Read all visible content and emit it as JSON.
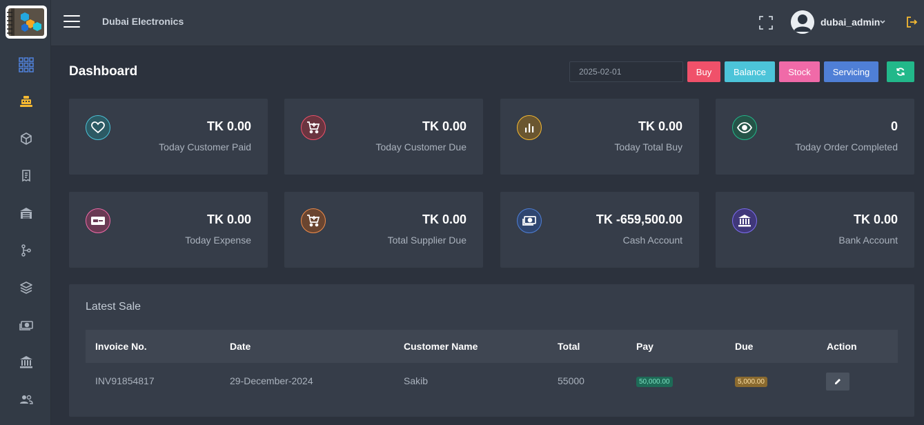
{
  "app": {
    "brand": "Dubai Electronics"
  },
  "user": {
    "name": "dubai_admin"
  },
  "page": {
    "title": "Dashboard"
  },
  "filter": {
    "date": "2025-02-01"
  },
  "actions": {
    "buy": "Buy",
    "balance": "Balance",
    "stock": "Stock",
    "servicing": "Servicing"
  },
  "colors": {
    "buy": "#f0516a",
    "balance": "#4cc4d9",
    "stock": "#f06aa8",
    "servicing": "#4f7fd6",
    "refresh": "#22b88a",
    "sidebar_active": "#4f7fd6",
    "sidebar_accent": "#f5b932"
  },
  "sidebar": {
    "items": [
      {
        "icon": "grid-icon"
      },
      {
        "icon": "cash-register-icon"
      },
      {
        "icon": "box-icon"
      },
      {
        "icon": "receipt-icon"
      },
      {
        "icon": "warehouse-icon"
      },
      {
        "icon": "hierarchy-icon"
      },
      {
        "icon": "layers-icon"
      },
      {
        "icon": "money-icon"
      },
      {
        "icon": "bank-icon"
      },
      {
        "icon": "users-icon"
      }
    ]
  },
  "stats": [
    {
      "value": "TK 0.00",
      "label": "Today Customer Paid",
      "icon": "heart-icon",
      "color": "#4cc4d9"
    },
    {
      "value": "TK 0.00",
      "label": "Today Customer Due",
      "icon": "cart-icon",
      "color": "#f0516a"
    },
    {
      "value": "TK 0.00",
      "label": "Today Total Buy",
      "icon": "bar-chart-icon",
      "color": "#f5b932"
    },
    {
      "value": "0",
      "label": "Today Order Completed",
      "icon": "eye-icon",
      "color": "#22b88a"
    },
    {
      "value": "TK 0.00",
      "label": "Today Expense",
      "icon": "money-card-icon",
      "color": "#f06aa8"
    },
    {
      "value": "TK 0.00",
      "label": "Total Supplier Due",
      "icon": "cart-plus-icon",
      "color": "#f08c4a"
    },
    {
      "value": "TK -659,500.00",
      "label": "Cash Account",
      "icon": "cash-icon",
      "color": "#4f7fd6"
    },
    {
      "value": "TK 0.00",
      "label": "Bank Account",
      "icon": "bank-icon",
      "color": "#7c6cf0"
    }
  ],
  "latest_sale": {
    "title": "Latest Sale",
    "columns": [
      "Invoice No.",
      "Date",
      "Customer Name",
      "Total",
      "Pay",
      "Due",
      "Action"
    ],
    "rows": [
      {
        "invoice": "INV91854817",
        "date": "29-December-2024",
        "customer": "Sakib",
        "total": "55000",
        "pay": "50,000.00",
        "due": "5,000.00"
      }
    ]
  }
}
